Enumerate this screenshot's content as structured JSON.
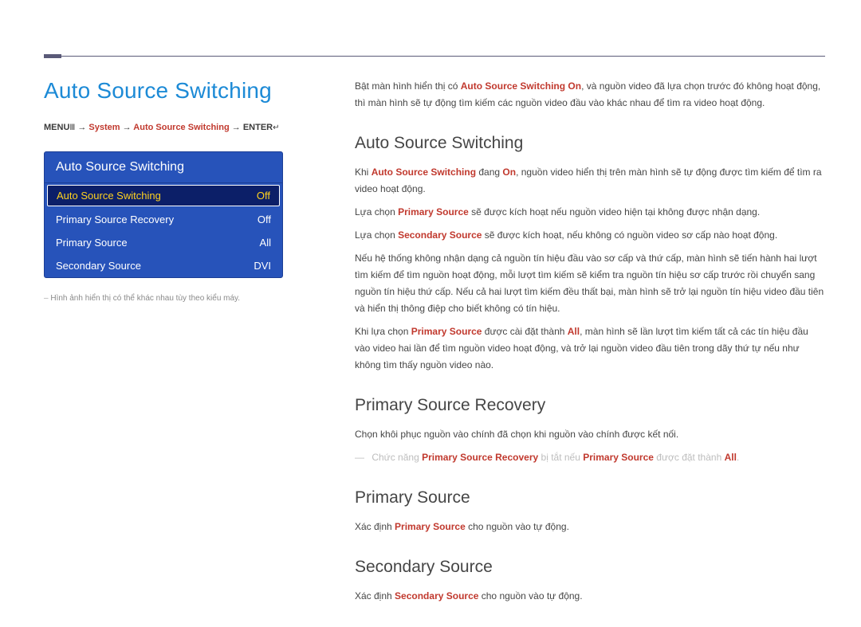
{
  "page": {
    "title": "Auto Source Switching"
  },
  "breadcrumb": {
    "menu": "MENU",
    "icon1": "Ⅲ",
    "arrow": "→",
    "seg1": "System",
    "seg2": "Auto Source Switching",
    "enter": "ENTER",
    "icon2": "↵"
  },
  "osd": {
    "header": "Auto Source Switching",
    "rows": [
      {
        "label": "Auto Source Switching",
        "value": "Off",
        "selected": true
      },
      {
        "label": "Primary Source Recovery",
        "value": "Off",
        "selected": false
      },
      {
        "label": "Primary Source",
        "value": "All",
        "selected": false
      },
      {
        "label": "Secondary Source",
        "value": "DVI",
        "selected": false
      }
    ],
    "caption": "Hình ảnh hiển thị có thể khác nhau tùy theo kiểu máy."
  },
  "intro": {
    "t1a": "Bật màn hình hiển thị có ",
    "kw1": "Auto Source Switching On",
    "t1b": ", và nguồn video đã lựa chọn trước đó không hoạt động, thì màn hình sẽ tự động tìm kiếm các nguồn video đầu vào khác nhau để tìm ra video hoạt động."
  },
  "s1": {
    "h": "Auto Source Switching",
    "p1a": "Khi ",
    "p1kw1": "Auto Source Switching",
    "p1b": " đang ",
    "p1kw2": "On",
    "p1c": ", nguồn video hiển thị trên màn hình sẽ tự động được tìm kiếm để tìm ra video hoạt động.",
    "p2a": "Lựa chọn ",
    "p2kw": "Primary Source",
    "p2b": " sẽ được kích hoạt nếu nguồn video hiện tại không được nhận dạng.",
    "p3a": "Lựa chọn ",
    "p3kw": "Secondary Source",
    "p3b": " sẽ được kích hoạt, nếu không có nguồn video sơ cấp nào hoạt động.",
    "p4": "Nếu hệ thống không nhận dạng cả nguồn tín hiệu đầu vào sơ cấp và thứ cấp, màn hình sẽ tiến hành hai lượt tìm kiếm để tìm nguồn hoạt động, mỗi lượt tìm kiếm sẽ kiểm tra nguồn tín hiệu sơ cấp trước rồi chuyển sang nguồn tín hiệu thứ cấp. Nếu cả hai lượt tìm kiếm đều thất bại, màn hình sẽ trở lại nguồn tín hiệu video đầu tiên và hiển thị thông điệp cho biết không có tín hiệu.",
    "p5a": "Khi lựa chọn ",
    "p5kw1": "Primary Source",
    "p5b": " được cài đặt thành ",
    "p5kw2": "All",
    "p5c": ", màn hình sẽ lần lượt tìm kiếm tất cả các tín hiệu đầu vào video hai lần để tìm nguồn video hoạt động, và trở lại nguồn video đầu tiên trong dãy thứ tự nếu như không tìm thấy nguồn video nào."
  },
  "s2": {
    "h": "Primary Source Recovery",
    "p1": "Chọn khôi phục nguồn vào chính đã chọn khi nguồn vào chính được kết nối.",
    "note_a": "Chức năng ",
    "note_kw1": "Primary Source Recovery",
    "note_b": " bị tắt nếu ",
    "note_kw2": "Primary Source",
    "note_c": " được đặt thành ",
    "note_kw3": "All",
    "note_d": "."
  },
  "s3": {
    "h": "Primary Source",
    "p1a": "Xác định ",
    "p1kw": "Primary Source",
    "p1b": " cho nguồn vào tự động."
  },
  "s4": {
    "h": "Secondary Source",
    "p1a": "Xác định ",
    "p1kw": "Secondary Source",
    "p1b": " cho nguồn vào tự động."
  }
}
